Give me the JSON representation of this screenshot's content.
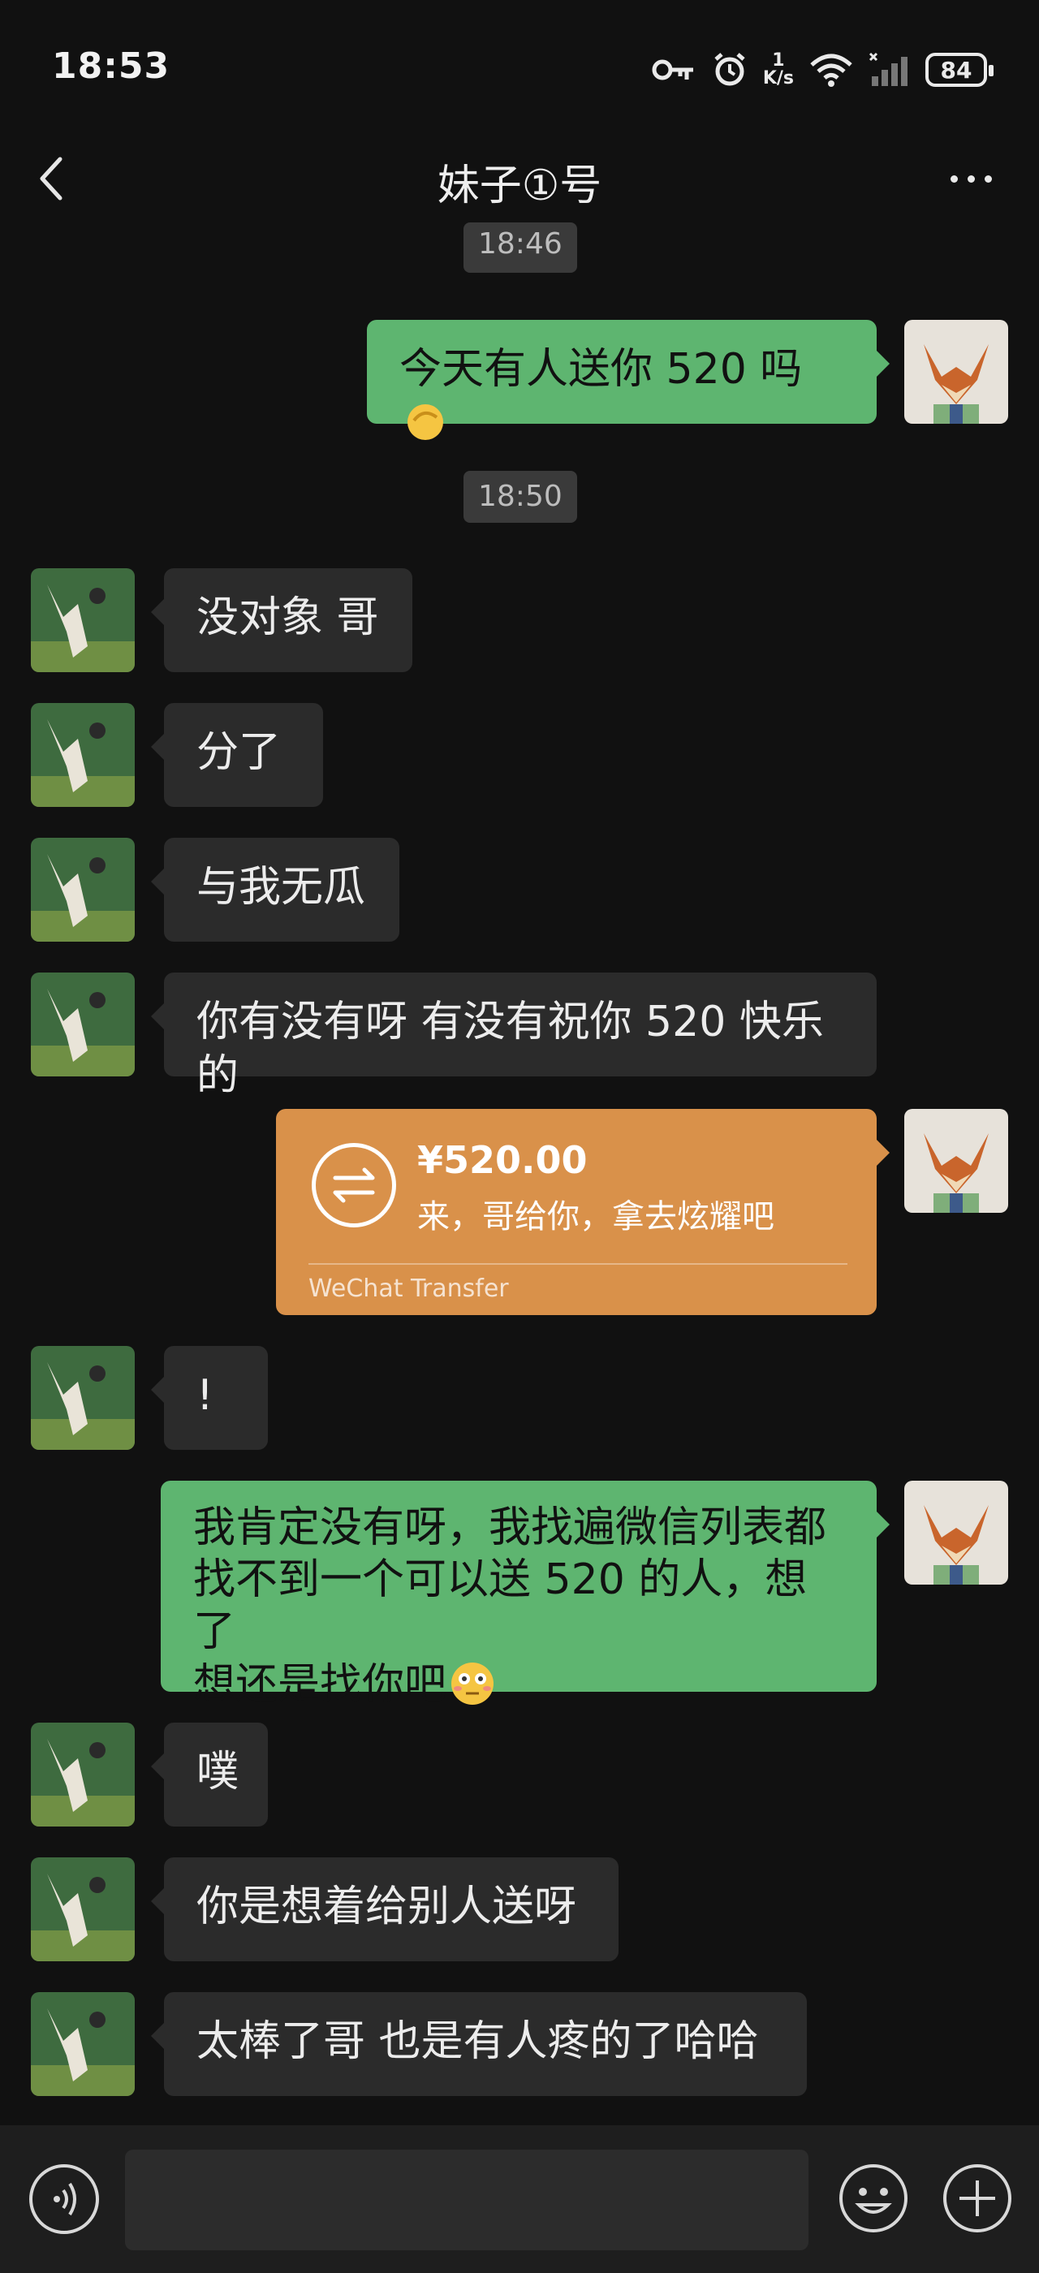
{
  "status_bar": {
    "time": "18:53",
    "net_speed_value": "1",
    "net_speed_unit": "K/s",
    "battery": "84"
  },
  "header": {
    "title": "妹子①号"
  },
  "messages": {
    "time1": "18:46",
    "m1": "今天有人送你 520 吗",
    "time2": "18:50",
    "m2": "没对象 哥",
    "m3": "分了",
    "m4": "与我无瓜",
    "m5": "你有没有呀 有没有祝你 520 快乐的",
    "transfer": {
      "amount": "¥520.00",
      "note": "来，哥给你，拿去炫耀吧",
      "brand": "WeChat Transfer",
      "accent": "#d9914a"
    },
    "m6": "!",
    "m7_l1": "我肯定没有呀，我找遍微信列表都",
    "m7_l2": "找不到一个可以送 520 的人，想了",
    "m7_l3": "想还是找你吧",
    "m8": "噗",
    "m9": "你是想着给别人送呀",
    "m10": "太棒了哥 也是有人疼的了哈哈"
  },
  "colors": {
    "background": "#111111",
    "outgoing_bubble": "#5eb570",
    "incoming_bubble": "#2b2b2b"
  },
  "icons": {
    "m1_emoji": "pinching-hand-emoji",
    "m7_emoji": "flushed-face-emoji"
  },
  "input": {
    "placeholder": ""
  }
}
